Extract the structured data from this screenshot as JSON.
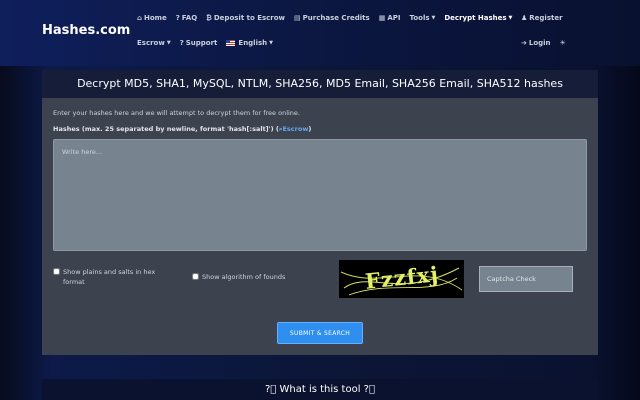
{
  "brand": "Hashes.com",
  "nav": {
    "home": "Home",
    "faq": "FAQ",
    "deposit": "Deposit to Escrow",
    "purchase": "Purchase Credits",
    "api": "API",
    "tools": "Tools",
    "decrypt": "Decrypt Hashes",
    "register": "Register",
    "escrow": "Escrow",
    "support": "Support",
    "language": "English",
    "login": "Login"
  },
  "panel": {
    "title": "Decrypt MD5, SHA1, MySQL, NTLM, SHA256, MD5 Email, SHA256 Email, SHA512 hashes",
    "intro": "Enter your hashes here and we will attempt to decrypt them for free online.",
    "field_label": "Hashes (max. 25 separated by newline, format 'hash[:salt]') (",
    "field_label_link": "Escrow",
    "field_label_end": ")",
    "hash_placeholder": "Write here...",
    "option_hex_line1": "Show plains and salts in hex",
    "option_hex_line2": "format",
    "option_algorithm": "Show algorithm of founds",
    "captcha_text": "Fzzfxj",
    "captcha_placeholder": "Captcha Check",
    "submit_label": "SUBMIT & SEARCH"
  },
  "footer_section": {
    "title": "What is this tool"
  },
  "colors": {
    "accent": "#2f8ff0",
    "link": "#63a9f0",
    "panel_bg": "#3c434e",
    "header_bg": "#151d38"
  }
}
